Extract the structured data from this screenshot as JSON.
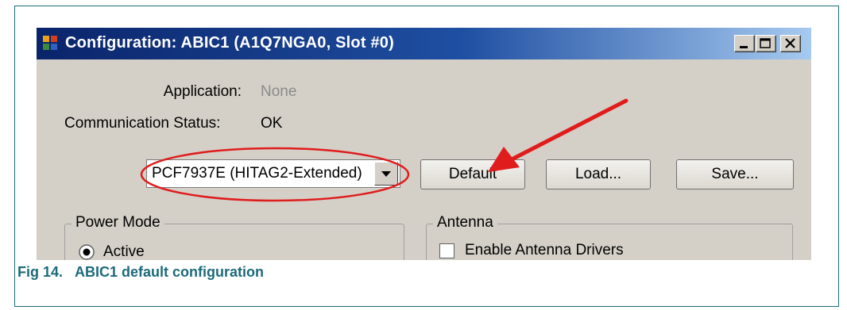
{
  "window": {
    "title": "Configuration: ABIC1 (A1Q7NGA0, Slot #0)",
    "controls": [
      "minimize",
      "maximize",
      "close"
    ]
  },
  "info": {
    "application_label": "Application:",
    "application_value": "None",
    "status_label": "Communication Status:",
    "status_value": "OK"
  },
  "toolbar": {
    "device_select_value": "PCF7937E (HITAG2-Extended)",
    "default_label": "Default",
    "load_label": "Load...",
    "save_label": "Save..."
  },
  "groups": {
    "power_mode_title": "Power Mode",
    "power_mode_option": "Active",
    "antenna_title": "Antenna",
    "antenna_option": "Enable Antenna Drivers"
  },
  "annotations": {
    "highlight_color": "#e01c1c"
  },
  "caption": {
    "text": "Fig 14.   ABIC1 default configuration"
  }
}
